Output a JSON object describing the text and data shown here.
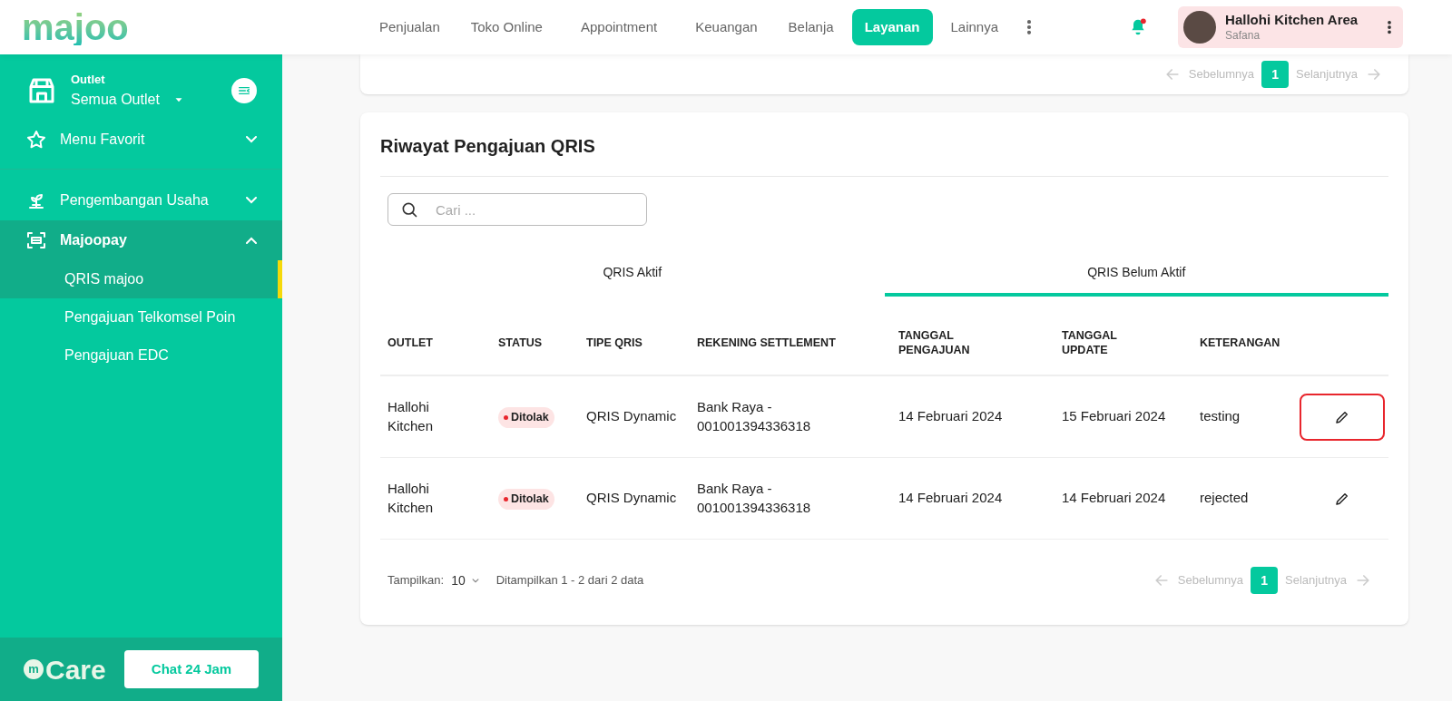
{
  "header": {
    "logo": "majoo",
    "nav": [
      {
        "label": "Penjualan",
        "selected": false
      },
      {
        "label": "Toko Online",
        "selected": false
      },
      {
        "label": "Appointment",
        "selected": false
      },
      {
        "label": "Keuangan",
        "selected": false
      },
      {
        "label": "Belanja",
        "selected": false
      },
      {
        "label": "Layanan",
        "selected": true
      },
      {
        "label": "Lainnya",
        "selected": false
      }
    ],
    "notification": {
      "unread": true
    },
    "account": {
      "name": "Hallohi Kitchen Area",
      "user": "Safana"
    }
  },
  "sidebar": {
    "outlet": {
      "label": "Outlet",
      "value": "Semua Outlet"
    },
    "items": [
      {
        "label": "Menu Favorit",
        "expanded": false
      },
      {
        "label": "Pengembangan Usaha",
        "expanded": false
      },
      {
        "label": "Majoopay",
        "expanded": true,
        "children": [
          {
            "label": "QRIS majoo",
            "selected": true
          },
          {
            "label": "Pengajuan Telkomsel Poin",
            "selected": false
          },
          {
            "label": "Pengajuan EDC",
            "selected": false
          }
        ]
      }
    ],
    "care": {
      "mark": "m",
      "text": "Care",
      "button": "Chat 24 Jam"
    }
  },
  "top_card": {
    "pagination": {
      "prev": "Sebelumnya",
      "page": "1",
      "next": "Selanjutnya"
    }
  },
  "card": {
    "title": "Riwayat Pengajuan QRIS",
    "search": {
      "placeholder": "Cari ..."
    },
    "tabs": [
      {
        "label": "QRIS Aktif",
        "selected": false
      },
      {
        "label": "QRIS Belum Aktif",
        "selected": true
      }
    ],
    "table": {
      "columns": [
        "OUTLET",
        "STATUS",
        "TIPE QRIS",
        "REKENING SETTLEMENT",
        "TANGGAL PENGAJUAN",
        "TANGGAL UPDATE",
        "KETERANGAN"
      ],
      "rows": [
        {
          "outlet": "Hallohi Kitchen",
          "status": "Ditolak",
          "tipe": "QRIS Dynamic",
          "rekening": "Bank Raya - 001001394336318",
          "pengajuan": "14 Februari 2024",
          "update": "15 Februari 2024",
          "keterangan": "testing",
          "highlighted": true
        },
        {
          "outlet": "Hallohi Kitchen",
          "status": "Ditolak",
          "tipe": "QRIS Dynamic",
          "rekening": "Bank Raya - 001001394336318",
          "pengajuan": "14 Februari 2024",
          "update": "14 Februari 2024",
          "keterangan": "rejected",
          "highlighted": false
        }
      ]
    },
    "footer": {
      "show_label": "Tampilkan:",
      "page_size": "10",
      "summary": "Ditampilkan 1 - 2 dari 2 data",
      "pagination": {
        "prev": "Sebelumnya",
        "page": "1",
        "next": "Selanjutnya"
      }
    }
  }
}
